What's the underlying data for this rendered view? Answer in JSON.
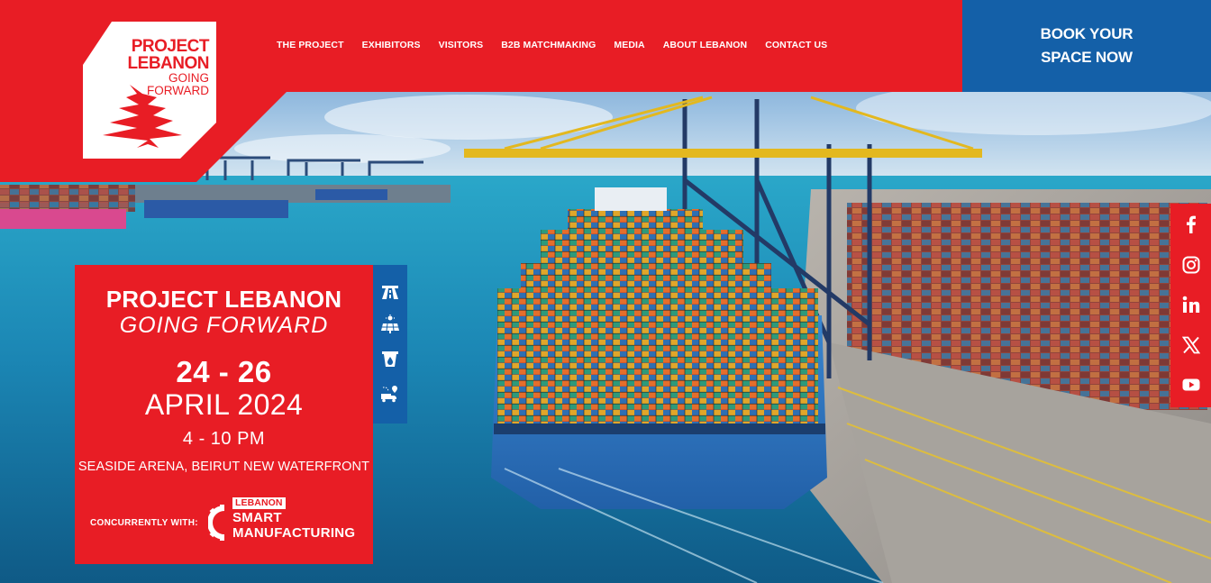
{
  "header": {
    "logo": {
      "line1": "PROJECT",
      "line2": "LEBANON",
      "line3": "GOING",
      "line4": "FORWARD"
    },
    "nav": [
      {
        "label": "THE PROJECT"
      },
      {
        "label": "EXHIBITORS"
      },
      {
        "label": "VISITORS"
      },
      {
        "label": "B2B MATCHMAKING"
      },
      {
        "label": "MEDIA"
      },
      {
        "label": "ABOUT LEBANON"
      },
      {
        "label": "CONTACT US"
      }
    ],
    "book_button": {
      "line1": "BOOK YOUR",
      "line2": "SPACE NOW"
    }
  },
  "event": {
    "title": "PROJECT LEBANON",
    "subtitle": "GOING FORWARD",
    "days": "24 - 26",
    "month_year": "APRIL 2024",
    "time": "4 - 10 PM",
    "venue": "SEASIDE ARENA, BEIRUT NEW WATERFRONT",
    "concurrent_label": "CONCURRENTLY WITH:",
    "concurrent_event": {
      "badge": "LEBANON",
      "line1": "SMART",
      "line2": "MANUFACTURING"
    }
  },
  "sectors": [
    {
      "icon": "highway-icon"
    },
    {
      "icon": "solar-panel-icon"
    },
    {
      "icon": "water-dam-icon"
    },
    {
      "icon": "logistics-truck-icon"
    }
  ],
  "social": [
    {
      "icon": "facebook-icon"
    },
    {
      "icon": "instagram-icon"
    },
    {
      "icon": "linkedin-icon"
    },
    {
      "icon": "x-icon"
    },
    {
      "icon": "youtube-icon"
    }
  ],
  "colors": {
    "brand_red": "#e81d25",
    "brand_blue": "#1460a8"
  }
}
